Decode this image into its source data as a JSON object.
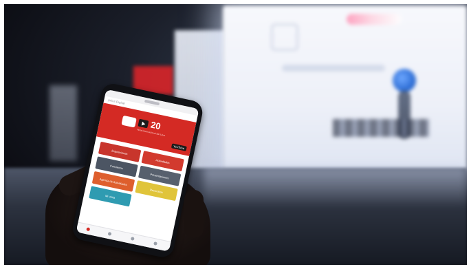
{
  "phone": {
    "app_title": "Julius Digital",
    "banner": {
      "number": "20",
      "subtitle": "Feria Internacional del Libro",
      "badge": "YouTube"
    },
    "tiles": [
      {
        "label": "Exposiciones",
        "color": "#c8352c"
      },
      {
        "label": "Actividades",
        "color": "#d23a2e"
      },
      {
        "label": "Conciertos",
        "color": "#4c5563"
      },
      {
        "label": "Presentaciones",
        "color": "#57606d"
      },
      {
        "label": "Agenda de Actividades",
        "color": "#de5f2d"
      },
      {
        "label": "Recorridos",
        "color": "#e0c43a"
      },
      {
        "label": "Mi visita",
        "color": "#2f9bb1"
      }
    ],
    "nav_icons": [
      "home-icon",
      "search-icon",
      "profile-icon",
      "menu-icon"
    ]
  }
}
